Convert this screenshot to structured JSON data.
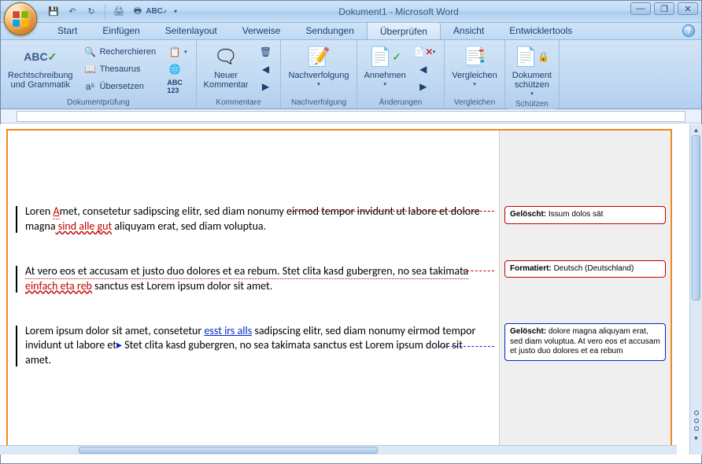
{
  "title": "Dokument1 - Microsoft Word",
  "qat": {
    "save": "save-icon",
    "undo": "undo-icon",
    "redo": "redo-icon",
    "print": "print-icon",
    "quickprint": "quick-print-icon",
    "spelling": "spelling-icon"
  },
  "tabs": {
    "start": "Start",
    "insert": "Einfügen",
    "pagelayout": "Seitenlayout",
    "references": "Verweise",
    "mailings": "Sendungen",
    "review": "Überprüfen",
    "view": "Ansicht",
    "developer": "Entwicklertools"
  },
  "ribbon": {
    "group_proofing": "Dokumentprüfung",
    "spelling": "Rechtschreibung\nund Grammatik",
    "research": "Recherchieren",
    "thesaurus": "Thesaurus",
    "translate": "Übersetzen",
    "group_comments": "Kommentare",
    "new_comment": "Neuer\nKommentar",
    "group_tracking": "Nachverfolgung",
    "tracking": "Nachverfolgung",
    "group_changes": "Änderungen",
    "accept": "Annehmen",
    "group_compare": "Vergleichen",
    "compare": "Vergleichen",
    "group_protect": "Schützen",
    "protect": "Dokument\nschützen"
  },
  "document": {
    "p1_a": "Loren ",
    "p1_ins1": "A",
    "p1_b": "met, consetetur sadipscing elitr, sed diam nonumy eirmod tempor invidunt ut labore et dolore magna",
    "p1_ins2": " sind alle gut",
    "p1_c": " aliquyam erat, sed diam voluptua.",
    "p2_a": "At vero eos et accusam et justo duo dolores et ea rebum. Stet clita kasd gubergren, no sea takimata ",
    "p2_wave": "einfach eta reb",
    "p2_b": " sanctus est Lorem ipsum dolor sit amet.",
    "p3_a": "Lorem ipsum dolor sit amet, consetetur ",
    "p3_ins": " esst irs alls",
    "p3_b": " sadipscing elitr, sed diam nonumy eirmod tempor invidunt ut labore et",
    "p3_caret": "▸",
    "p3_c": " Stet clita kasd gubergren, no sea takimata sanctus est Lorem ipsum dolor sit amet."
  },
  "balloons": {
    "b1_label": "Gelöscht:",
    "b1_text": " Issum dolos sät",
    "b2_label": "Formatiert:",
    "b2_text": " Deutsch (Deutschland)",
    "b3_label": "Gelöscht:",
    "b3_text": "  dolore magna aliquyam erat, sed diam voluptua. At vero eos et accusam et justo duo dolores et ea rebum"
  },
  "winbuttons": {
    "min": "—",
    "max": "❐",
    "close": "✕"
  }
}
